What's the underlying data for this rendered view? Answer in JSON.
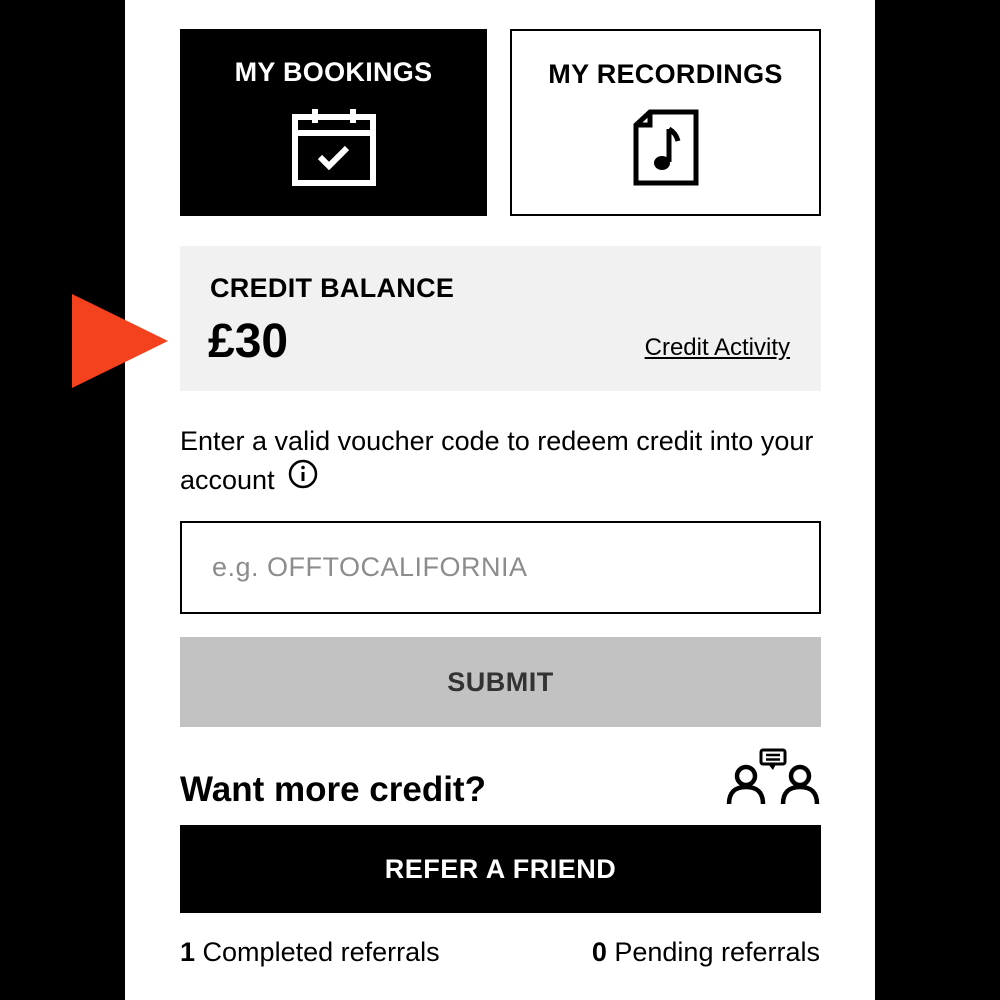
{
  "tiles": {
    "bookings": {
      "title": "MY BOOKINGS",
      "icon": "calendar-check-icon"
    },
    "recordings": {
      "title": "MY RECORDINGS",
      "icon": "music-file-icon"
    }
  },
  "credit": {
    "label": "CREDIT BALANCE",
    "amount": "£30",
    "activity_link": "Credit Activity"
  },
  "voucher": {
    "instructions": "Enter a valid voucher code to redeem credit into your account",
    "placeholder": "e.g. OFFTOCALIFORNIA",
    "value": "",
    "submit_label": "SUBMIT"
  },
  "referral": {
    "heading": "Want more credit?",
    "button_label": "REFER A FRIEND",
    "completed_count": "1",
    "completed_label": "Completed referrals",
    "pending_count": "0",
    "pending_label": "Pending referrals"
  },
  "colors": {
    "accent_arrow": "#f4411e",
    "credit_box_bg": "#f1f1f1",
    "submit_disabled_bg": "#c2c2c2"
  }
}
